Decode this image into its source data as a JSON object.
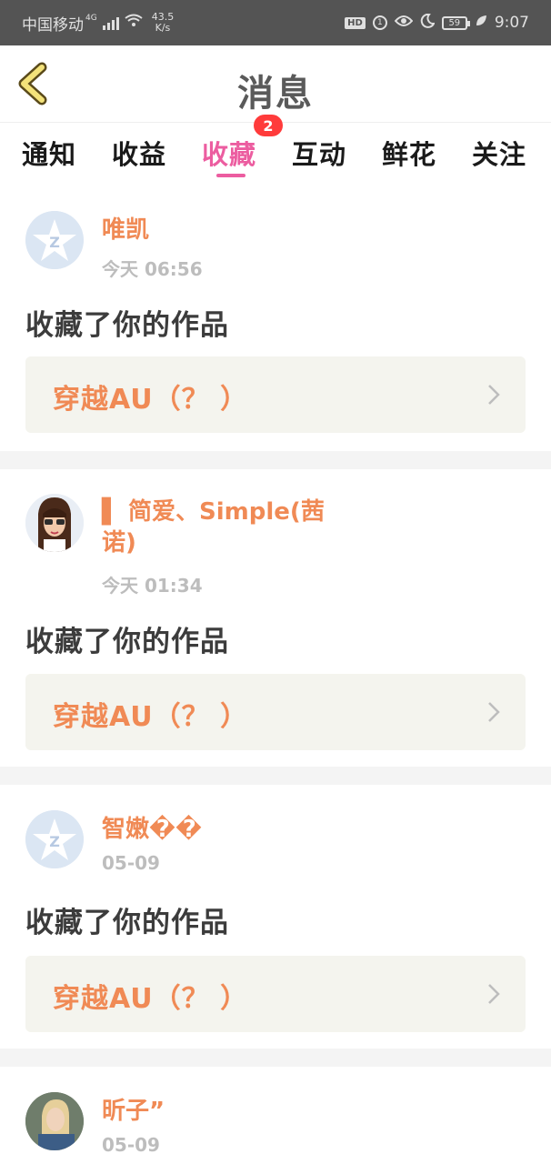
{
  "status_bar": {
    "carrier": "中国移动",
    "network": "4G",
    "speed_value": "43.5",
    "speed_unit": "K/s",
    "hd": "HD",
    "battery": "59",
    "time": "9:07"
  },
  "header": {
    "title": "消息",
    "back_icon": "chevron-left-icon"
  },
  "tabs": [
    {
      "label": "通知"
    },
    {
      "label": "收益"
    },
    {
      "label": "收藏",
      "active": true,
      "badge": "2"
    },
    {
      "label": "互动"
    },
    {
      "label": "鲜花"
    },
    {
      "label": "关注"
    }
  ],
  "messages": [
    {
      "user": "唯凯",
      "time": "今天 06:56",
      "action": "收藏了你的作品",
      "work": "穿越AU（？ ）",
      "avatar": "default-avatar"
    },
    {
      "user": "▌ 简爱、Simple(茜诺)",
      "time": "今天 01:34",
      "action": "收藏了你的作品",
      "work": "穿越AU（？ ）",
      "avatar": "girl-avatar"
    },
    {
      "user": "智嫩��",
      "time": "05-09",
      "action": "收藏了你的作品",
      "work": "穿越AU（？ ）",
      "avatar": "default-avatar"
    },
    {
      "user": "昕子”",
      "time": "05-09",
      "avatar": "photo-avatar"
    }
  ],
  "colors": {
    "accent": "#ec5da0",
    "username": "#f08a55",
    "badge": "#ff3b3b",
    "status_bar": "#545454"
  }
}
